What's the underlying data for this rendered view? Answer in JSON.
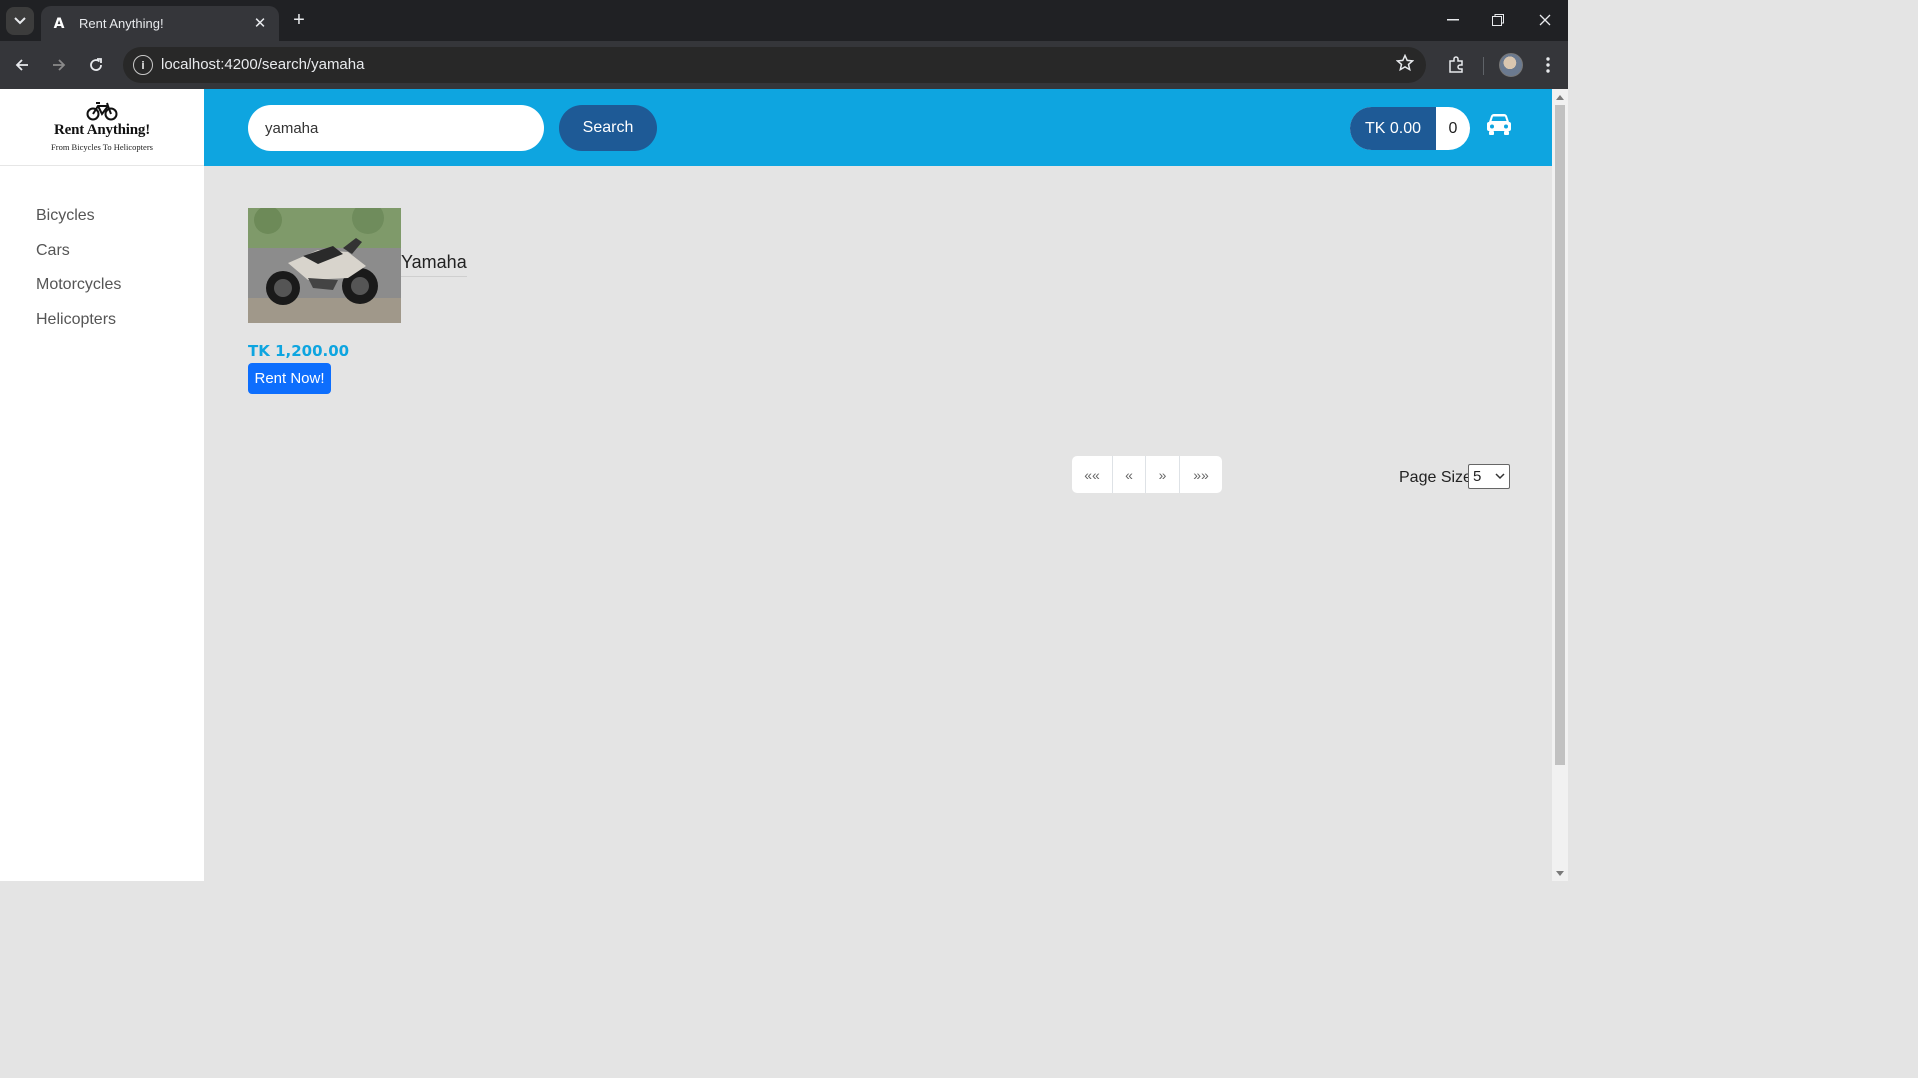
{
  "browser": {
    "tab_title": "Rent Anything!",
    "tab_favicon": "A",
    "url": "localhost:4200/search/yamaha"
  },
  "logo": {
    "title": "Rent Anything!",
    "subtitle": "From Bicycles To Helicopters"
  },
  "sidebar": {
    "items": [
      {
        "label": "Bicycles"
      },
      {
        "label": "Cars"
      },
      {
        "label": "Motorcycles"
      },
      {
        "label": "Helicopters"
      }
    ]
  },
  "header": {
    "search_value": "yamaha",
    "search_button": "Search",
    "cart_total": "TK 0.00",
    "cart_count": "0"
  },
  "products": [
    {
      "name": "Yamaha",
      "price": "TK 1,200.00",
      "action": "Rent Now!"
    }
  ],
  "pagination": {
    "first": "««",
    "prev": "«",
    "next": "»",
    "last": "»»",
    "page_size_label": "Page Size",
    "page_size_value": "5"
  },
  "colors": {
    "header_bg": "#0ea5e0",
    "button_dark": "#1e5a96",
    "rent_button": "#0d6efd",
    "price": "#0ea5e0"
  }
}
